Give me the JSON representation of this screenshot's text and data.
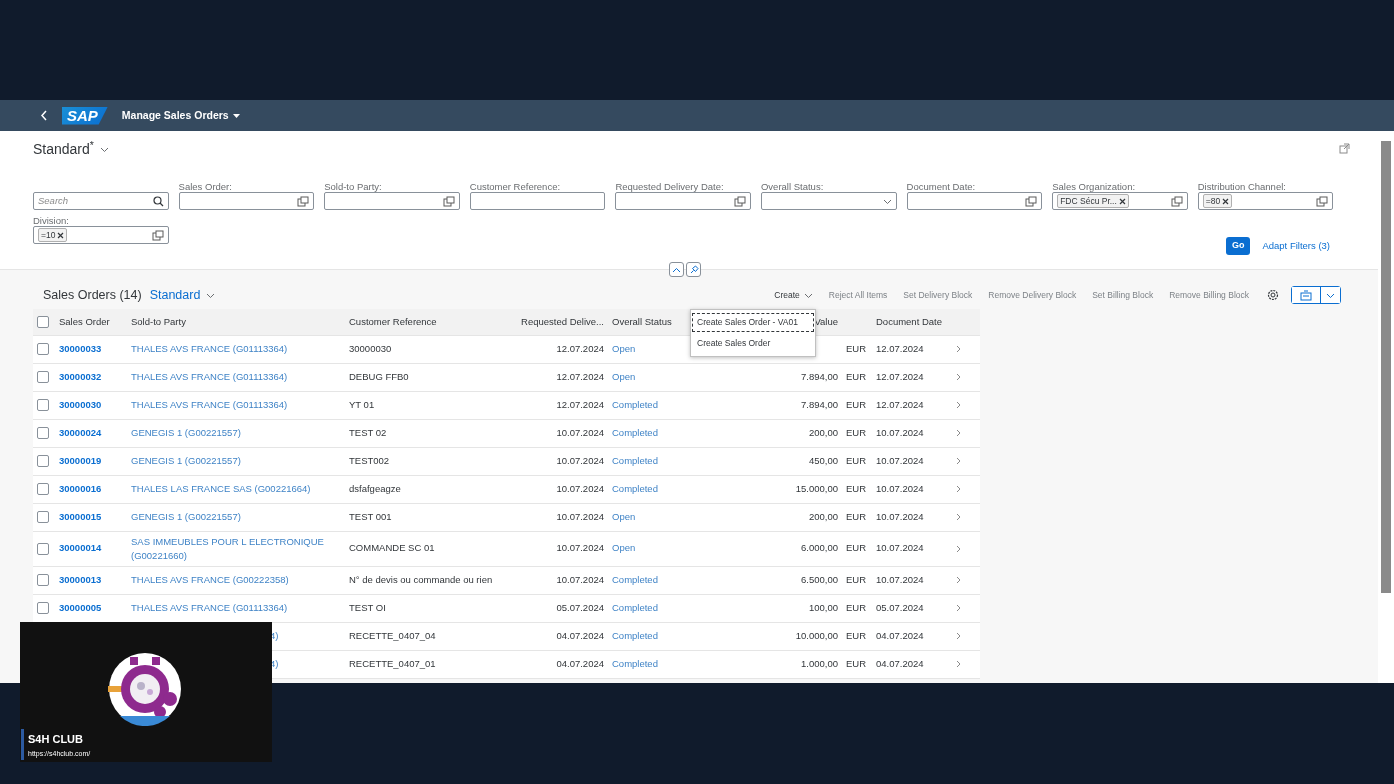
{
  "shell": {
    "logo": "SAP",
    "app_title": "Manage Sales Orders"
  },
  "variant": {
    "name": "Standard$^{*}$"
  },
  "search": {
    "placeholder": "Search"
  },
  "filters": [
    {
      "label": "Sales Order:",
      "kind": "value_help"
    },
    {
      "label": "Sold-to Party:",
      "kind": "value_help"
    },
    {
      "label": "Customer Reference:",
      "kind": "text"
    },
    {
      "label": "Requested Delivery Date:",
      "kind": "value_help"
    },
    {
      "label": "Overall Status:",
      "kind": "select"
    },
    {
      "label": "Document Date:",
      "kind": "value_help"
    },
    {
      "label": "Sales Organization:",
      "kind": "value_help",
      "tokens": [
        "FDC Sécu Pr..."
      ]
    },
    {
      "label": "Distribution Channel:",
      "kind": "value_help",
      "tokens": [
        "=80"
      ]
    },
    {
      "label": "Division:",
      "kind": "value_help",
      "tokens": [
        "=10"
      ]
    }
  ],
  "go_button": "Go",
  "adapt_filters": "Adapt Filters (3)",
  "table": {
    "title": "Sales Orders (14)",
    "variant": "Standard",
    "toolbar": [
      {
        "label": "Create",
        "disabled": false
      },
      {
        "label": "Reject All Items",
        "disabled": true
      },
      {
        "label": "Set Delivery Block",
        "disabled": true
      },
      {
        "label": "Remove Delivery Block",
        "disabled": true
      },
      {
        "label": "Set Billing Block",
        "disabled": true
      },
      {
        "label": "Remove Billing Block",
        "disabled": true
      }
    ],
    "create_menu": [
      {
        "label": "Create Sales Order - VA01",
        "focused": true
      },
      {
        "label": "Create Sales Order",
        "focused": false
      }
    ],
    "select_all": {
      "checked": false
    },
    "columns": [
      "Sales Order",
      "Sold-to Party",
      "Customer Reference",
      "Requested Delive...",
      "Overall Status",
      "Value",
      "Document Date"
    ],
    "rows": [
      {
        "kind": "full",
        "checked": false,
        "order": "30000033",
        "sold_to": "THALES AVS FRANCE (G01113364)",
        "reference": "30000030",
        "req_date": "12.07.2024",
        "status": "Open",
        "currency": "EUR",
        "doc_date": "12.07.2024"
      },
      {
        "kind": "full",
        "checked": false,
        "order": "30000032",
        "sold_to": "THALES AVS FRANCE (G01113364)",
        "reference": "DEBUG FFB0",
        "req_date": "12.07.2024",
        "status": "Open",
        "value": "7.894,00",
        "currency": "EUR",
        "doc_date": "12.07.2024"
      },
      {
        "kind": "full",
        "checked": false,
        "order": "30000030",
        "sold_to": "THALES AVS FRANCE (G01113364)",
        "reference": "YT 01",
        "req_date": "12.07.2024",
        "status": "Completed",
        "value": "7.894,00",
        "currency": "EUR",
        "doc_date": "12.07.2024"
      },
      {
        "kind": "full",
        "checked": false,
        "order": "30000024",
        "sold_to": "GENEGIS 1 (G00221557)",
        "reference": "TEST 02",
        "req_date": "10.07.2024",
        "status": "Completed",
        "value": "200,00",
        "currency": "EUR",
        "doc_date": "10.07.2024"
      },
      {
        "kind": "full",
        "checked": false,
        "order": "30000019",
        "sold_to": "GENEGIS 1 (G00221557)",
        "reference": "TEST002",
        "req_date": "10.07.2024",
        "status": "Completed",
        "value": "450,00",
        "currency": "EUR",
        "doc_date": "10.07.2024"
      },
      {
        "kind": "full",
        "checked": false,
        "order": "30000016",
        "sold_to": "THALES LAS FRANCE SAS (G00221664)",
        "reference": "dsfafgeagze",
        "req_date": "10.07.2024",
        "status": "Completed",
        "value": "15.000,00",
        "currency": "EUR",
        "doc_date": "10.07.2024"
      },
      {
        "kind": "full",
        "checked": false,
        "order": "30000015",
        "sold_to": "GENEGIS 1 (G00221557)",
        "reference": "TEST 001",
        "req_date": "10.07.2024",
        "status": "Open",
        "value": "200,00",
        "currency": "EUR",
        "doc_date": "10.07.2024"
      },
      {
        "kind": "full",
        "checked": false,
        "order": "30000014",
        "sold_to": "SAS IMMEUBLES POUR L ELECTRONIQUE (G00221660)",
        "reference": "COMMANDE SC 01",
        "req_date": "10.07.2024",
        "status": "Open",
        "value": "6.000,00",
        "currency": "EUR",
        "doc_date": "10.07.2024"
      },
      {
        "kind": "full",
        "checked": false,
        "order": "30000013",
        "sold_to": "THALES AVS FRANCE (G00222358)",
        "reference": "N° de devis ou commande ou rien",
        "req_date": "10.07.2024",
        "status": "Completed",
        "value": "6.500,00",
        "currency": "EUR",
        "doc_date": "10.07.2024"
      },
      {
        "kind": "full",
        "checked": false,
        "order": "30000005",
        "sold_to": "THALES AVS FRANCE (G01113364)",
        "reference": "TEST OI",
        "req_date": "05.07.2024",
        "status": "Completed",
        "value": "100,00",
        "currency": "EUR",
        "doc_date": "05.07.2024"
      },
      {
        "kind": "covered",
        "sold_to": "4)",
        "reference": "RECETTE_0407_04",
        "req_date": "04.07.2024",
        "status": "Completed",
        "value": "10.000,00",
        "currency": "EUR",
        "doc_date": "04.07.2024"
      },
      {
        "kind": "covered",
        "sold_to": "4)",
        "reference": "RECETTE_0407_01",
        "req_date": "04.07.2024",
        "status": "Completed",
        "value": "1.000,00",
        "currency": "EUR",
        "doc_date": "04.07.2024"
      }
    ]
  },
  "stream_overlay": {
    "name": "S4H CLUB",
    "url": "https://s4hclub.com/"
  }
}
